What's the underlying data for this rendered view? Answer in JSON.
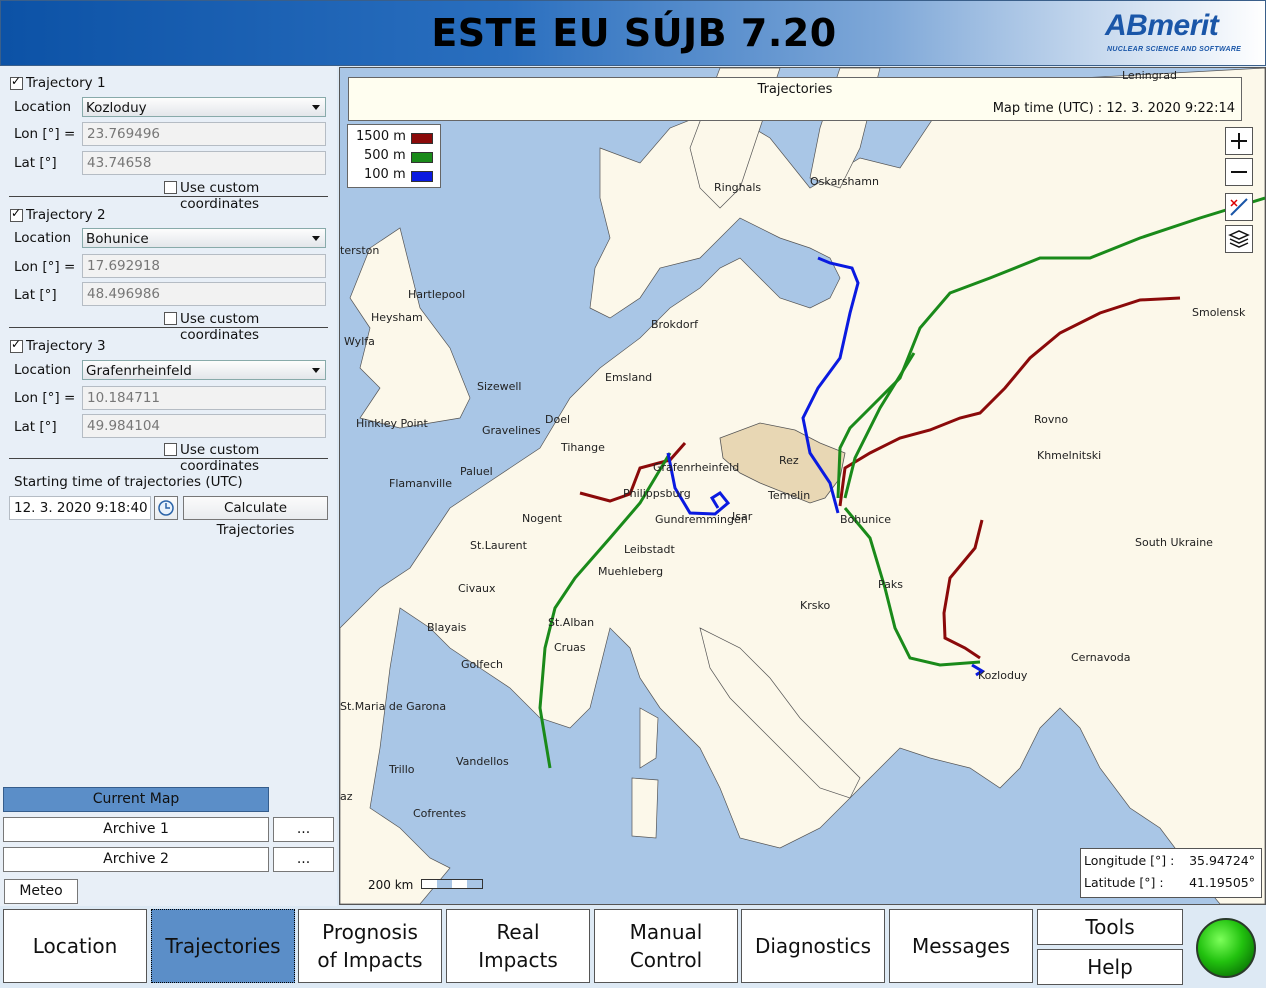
{
  "app_title": "ESTE EU SÚJB 7.20",
  "logo": {
    "text": "ABmerit",
    "tagline": "NUCLEAR SCIENCE AND SOFTWARE"
  },
  "trajectories": [
    {
      "label": "Trajectory 1",
      "checked": true,
      "location_label": "Location",
      "location": "Kozloduy",
      "lon_label": "Lon [°] =",
      "lon": "23.769496",
      "lat_label": "Lat [°]",
      "lat": "43.74658",
      "custom_label": "Use custom coordinates"
    },
    {
      "label": "Trajectory 2",
      "checked": true,
      "location_label": "Location",
      "location": "Bohunice",
      "lon_label": "Lon [°] =",
      "lon": "17.692918",
      "lat_label": "Lat [°]",
      "lat": "48.496986",
      "custom_label": "Use custom coordinates"
    },
    {
      "label": "Trajectory 3",
      "checked": true,
      "location_label": "Location",
      "location": "Grafenrheinfeld",
      "lon_label": "Lon [°] =",
      "lon": "10.184711",
      "lat_label": "Lat [°]",
      "lat": "49.984104",
      "custom_label": "Use custom coordinates"
    }
  ],
  "start_time": {
    "label": "Starting time of trajectories (UTC)",
    "value": "12. 3. 2020 9:18:40",
    "calc_button": "Calculate Trajectories"
  },
  "map_buttons": {
    "current": "Current Map",
    "archive1": "Archive 1",
    "archive2": "Archive 2",
    "dots": "...",
    "meteo": "Meteo"
  },
  "map": {
    "title": "Trajectories",
    "map_time": "Map time (UTC) : 12. 3. 2020 9:22:14",
    "legend": [
      {
        "label": "1500 m",
        "color": "#8b0a0a"
      },
      {
        "label": "500 m",
        "color": "#1a8a1a"
      },
      {
        "label": "100 m",
        "color": "#0a1ae0"
      }
    ],
    "longitude_label": "Longitude [°] :",
    "longitude": "35.94724°",
    "latitude_label": "Latitude  [°]    :",
    "latitude": "41.19505°",
    "scale": "200 km",
    "places": [
      "Leningrad",
      "Ringhals",
      "Oskarshamn",
      "terston",
      "Hartlepool",
      "Heysham",
      "Wylfa",
      "Brokdorf",
      "Smolensk",
      "Emsland",
      "Sizewell",
      "Doel",
      "Gravelines",
      "Hinkley Point",
      "Tihange",
      "Rovno",
      "Khmelnitski",
      "Paluel",
      "Flamanville",
      "Grafenrheinfeld",
      "Philippsburg",
      "Rez",
      "Temelin",
      "Nogent",
      "Gundremmingen",
      "Isar",
      "Bohunice",
      "St.Laurent",
      "Leibstadt",
      "South Ukraine",
      "Muehleberg",
      "Civaux",
      "Paks",
      "Krsko",
      "Blayais",
      "St.Alban",
      "Cruas",
      "Golfech",
      "Cernavoda",
      "Kozloduy",
      "St.Maria de Garona",
      "Vandellos",
      "Trillo",
      "az",
      "Cofrentes"
    ]
  },
  "tabs": [
    "Location",
    "Trajectories",
    "Prognosis of Impacts",
    "Real Impacts",
    "Manual Control",
    "Diagnostics",
    "Messages"
  ],
  "tools": "Tools",
  "help": "Help"
}
